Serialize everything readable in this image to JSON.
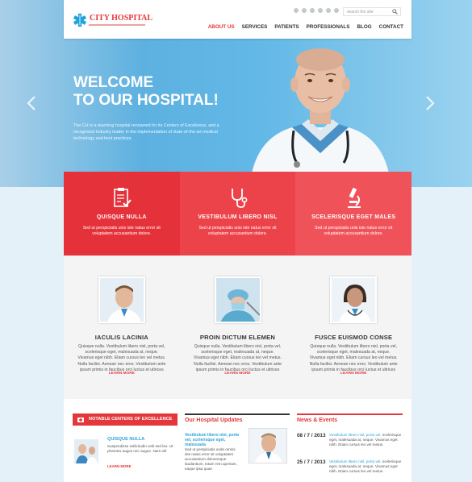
{
  "header": {
    "logo": "CITY HOSPITAL",
    "search_placeholder": "search the site",
    "nav": [
      "ABOUT US",
      "SERVICES",
      "PATIENTS",
      "PROFESSIONALS",
      "BLOG",
      "CONTACT"
    ]
  },
  "hero": {
    "title_line1": "WELCOME",
    "title_line2": "TO OUR HOSPITAL!",
    "text": "The CH is a teaching hospital renowned for its Centers of Excellence, and a recognized industry leader in the implementation of state-of-the-art medical technology and best practices."
  },
  "features": [
    {
      "title": "QUISQUE NULLA",
      "text": "Sed ut perspiciatis unis iste natus error sit voluptatem accusantium dolore.",
      "color": "#e5313a",
      "icon": "clipboard-icon"
    },
    {
      "title": "VESTIBULUM LIBERO NISL",
      "text": "Sed ut perspiciatis unis iste natus error sit voluptatem accusantium dolore.",
      "color": "#ec4249",
      "icon": "stethoscope-icon"
    },
    {
      "title": "SCELERISQUE EGET MALES",
      "text": "Sed ut perspiciatis unis iste natus error sit voluptatem accusantium dolore.",
      "color": "#f0525a",
      "icon": "microscope-icon"
    }
  ],
  "doctors": [
    {
      "title": "IACULIS LACINIA",
      "text": "Quisque nulla. Vestibulum libero nisl, porta vel, scelerisque eget, malesuada at, neque. Vivamus eget nibh. Etiam cursus leo vel metus. Nulla facilisi. Aenean nec eros. Vestibulum ante ipsum primis in faucibus orci luctus et ultrices",
      "learn": "LEARN MORE"
    },
    {
      "title": "PROIN DICTUM ELEMEN",
      "text": "Quisque nulla. Vestibulum libero nisl, porta vel, scelerisque eget, malesuada at, neque. Vivamus eget nibh. Etiam cursus leo vel metus. Nulla facilisi. Aenean nec eros. Vestibulum ante ipsum primis in faucibus orci luctus et ultrices",
      "learn": "LEARN MORE"
    },
    {
      "title": "FUSCE EUISMOD CONSE",
      "text": "Quisque nulla. Vestibulum libero nisl, porta vel, scelerisque eget, malesuada at, neque. Vivamus eget nibh. Etiam cursus leo vel metus. Nulla facilisi. Aenean nec eros. Vestibulum ante ipsum primis in faucibus orci luctus et ultrices",
      "learn": "LEARN MORE"
    }
  ],
  "bottom": {
    "col1": {
      "head": "NOTABLE CENTERS OF EXCELLENCE",
      "title": "QUISQUE NULLA",
      "text": "Suspendisse sollicitudin velit sed leo. Ut pharetra augue nec augue. Nam elit",
      "learn": "LEARN MORE"
    },
    "col2": {
      "head": "Our Hospital Updates",
      "title": "Vestibulum libero nisl, porta vel, scelerisque eget, malesuada",
      "text": "Sed ut perspiciatis unde omnis iste natus error sit voluptatem accusantium doloremque laudantium, totam rem aperiam, eaque ipsa quae"
    },
    "col3": {
      "head": "News & Events",
      "items": [
        {
          "date": "08 / 7 / 2013",
          "title": "Vestibulum libero nisl, porta vel,",
          "text": "scelerisque eget, malesuada at, neque. Vivamus eget nibh. Etiam cursus leo vel metus."
        },
        {
          "date": "25 / 7 / 2013",
          "title": "Vestibulum libero nisl, porta vel,",
          "text": "scelerisque eget, malesuada at, neque. Vivamus eget nibh. Etiam cursus leo vel metus."
        }
      ]
    }
  }
}
